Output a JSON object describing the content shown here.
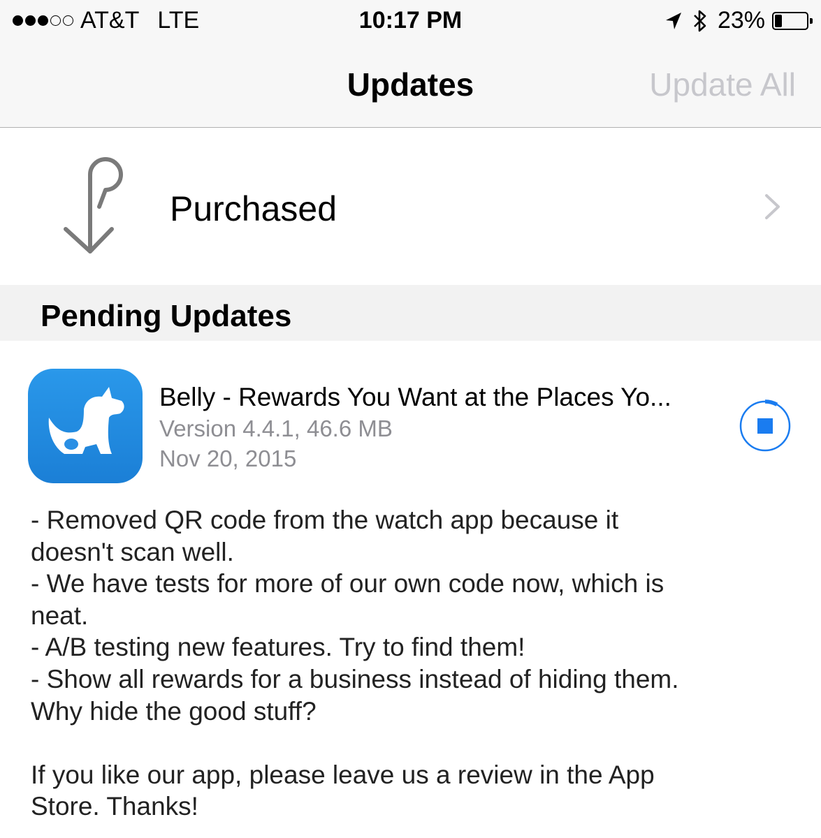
{
  "status_bar": {
    "signal_bars_filled": 3,
    "signal_bars_total": 5,
    "carrier": "AT&T",
    "network": "LTE",
    "time": "10:17 PM",
    "battery_percent": "23%",
    "battery_level": 0.23
  },
  "nav": {
    "title": "Updates",
    "action": "Update All"
  },
  "purchased": {
    "label": "Purchased",
    "icon": "purchased-download-icon"
  },
  "pending": {
    "header": "Pending Updates",
    "app": {
      "name": "Belly - Rewards You Want at the Places Yo...",
      "version_size": "Version 4.4.1, 46.6 MB",
      "date": "Nov 20, 2015",
      "icon": "belly-dog-icon",
      "download_progress": 0.08,
      "notes": [
        "- Removed QR code from the watch app because it",
        "doesn't scan well.",
        "- We have tests for more of our own code now, which is",
        "neat.",
        "- A/B testing new features. Try to find them!",
        "- Show all rewards for a business instead of hiding them.",
        "Why hide the good stuff?",
        "",
        "If you like our app, please leave us a review in the App",
        "Store. Thanks!"
      ]
    }
  },
  "colors": {
    "accent": "#1a7cf0",
    "bar_background": "#f7f7f7",
    "disabled_text": "#c7c7cc",
    "secondary_text": "#8e8e93"
  }
}
